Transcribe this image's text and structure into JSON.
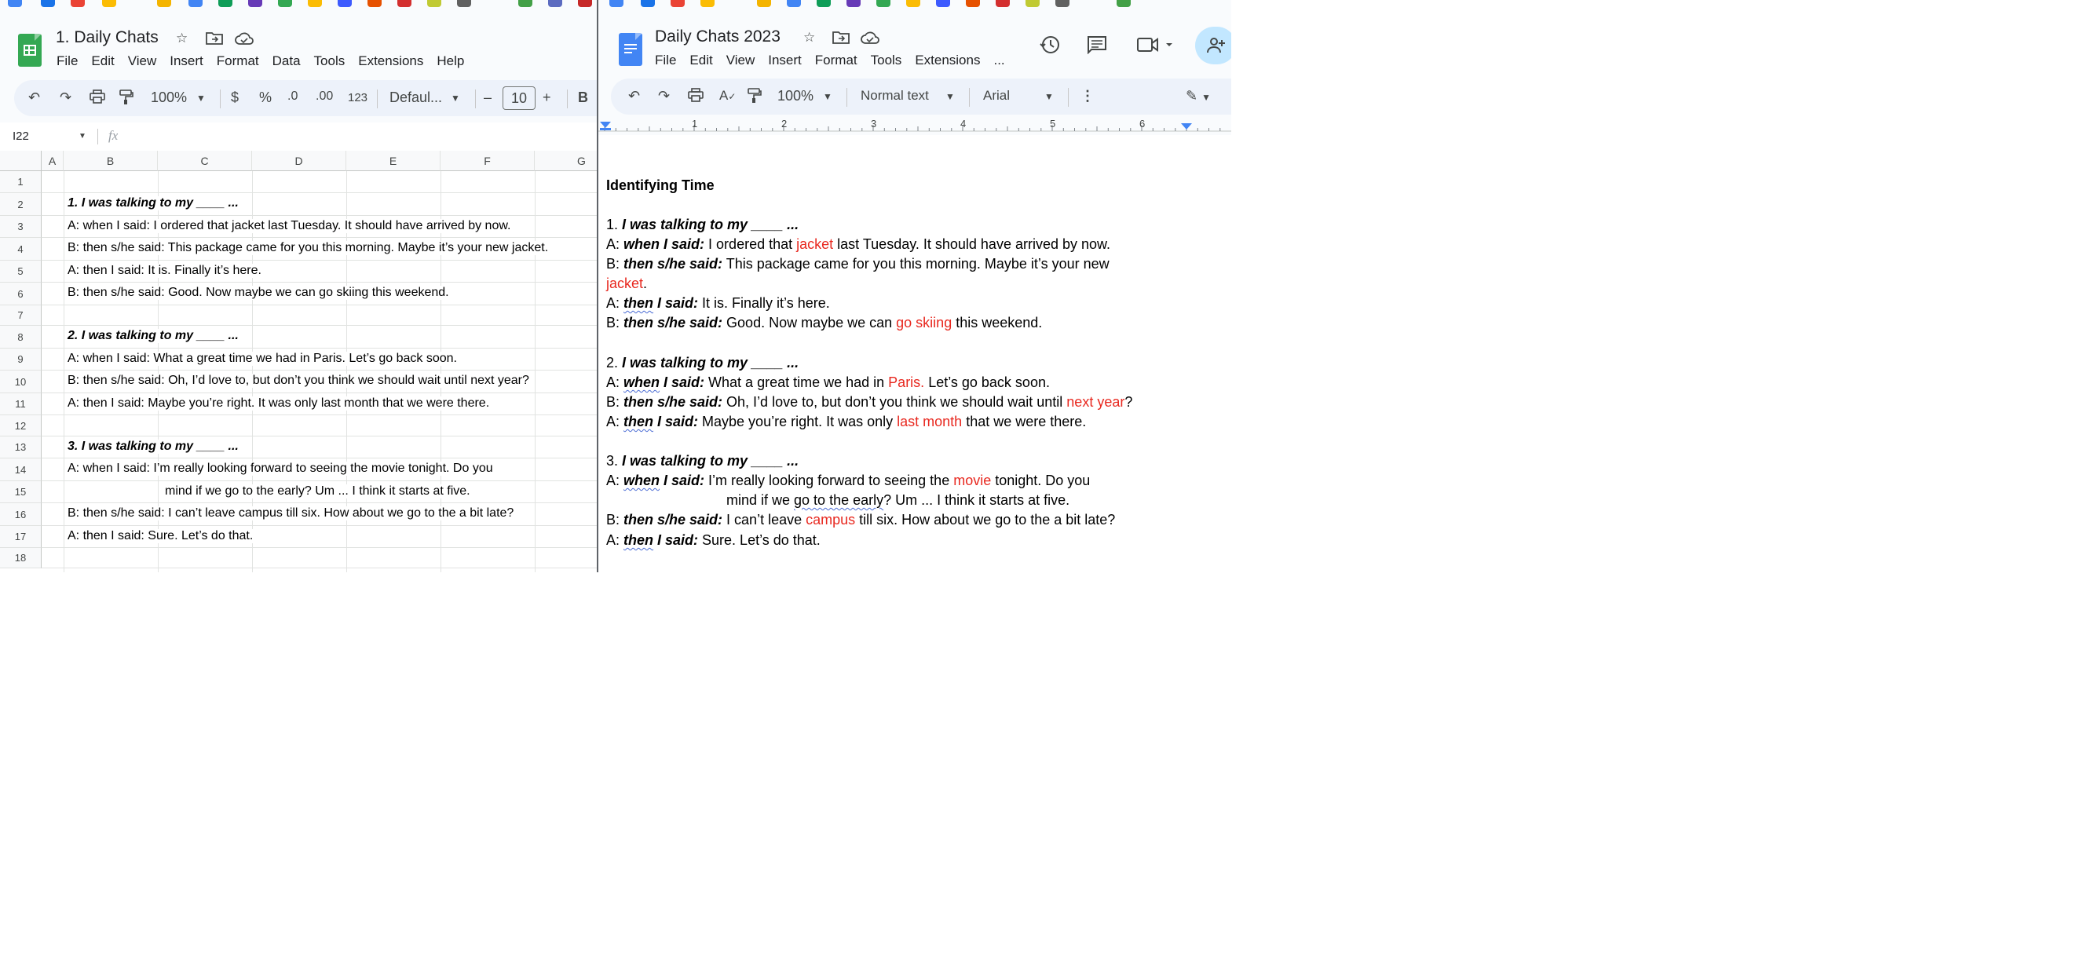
{
  "left_pane": {
    "title": "1. Daily Chats",
    "menu": [
      "File",
      "Edit",
      "View",
      "Insert",
      "Format",
      "Data",
      "Tools",
      "Extensions",
      "Help"
    ],
    "toolbar": {
      "zoom": "100%",
      "currency": "$",
      "percent": "%",
      "dec_decrease": ".0",
      "dec_increase": ".00",
      "number_format": "123",
      "font": "Defaul...",
      "minus": "–",
      "font_size": "10",
      "plus": "+",
      "bold": "B"
    },
    "name_box": "I22",
    "fx": "fx",
    "columns": [
      "A",
      "B",
      "C",
      "D",
      "E",
      "F",
      "G"
    ],
    "rows": [
      "1",
      "2",
      "3",
      "4",
      "5",
      "6",
      "7",
      "8",
      "9",
      "10",
      "11",
      "12",
      "13",
      "14",
      "15",
      "16",
      "17",
      "18"
    ],
    "cells": {
      "r2": "1. I was talking to my ____ ...",
      "r3": "A: when I said:  I ordered that jacket last Tuesday. It should have arrived by now.",
      "r4": "B: then s/he said:  This package came for you this morning. Maybe it’s your new jacket.",
      "r5": "A: then I said:  It is. Finally it’s here.",
      "r6": "B: then s/he said:  Good. Now maybe we can go skiing this weekend.",
      "r8": "2. I was talking to my ____ ...",
      "r9": "A: when I said:  What a great time we had in Paris. Let’s go back soon.",
      "r10": "B: then s/he said:  Oh, I’d love to, but don’t you think we should wait until next year?",
      "r11": "A: then I said:  Maybe you’re right. It was only last month that we were there.",
      "r13": "3. I was talking to my ____ ...",
      "r14": "A: when I said:  I’m really looking forward to seeing the movie tonight. Do you",
      "r15": "mind if we go to the early? Um ... I think it starts at five.",
      "r16": "B: then s/he said:  I can’t leave campus till six. How about we go to the a bit late?",
      "r17": "A: then I said:  Sure. Let’s do that."
    }
  },
  "right_pane": {
    "title": "Daily Chats 2023",
    "menu": [
      "File",
      "Edit",
      "View",
      "Insert",
      "Format",
      "Tools",
      "Extensions",
      "..."
    ],
    "toolbar": {
      "zoom": "100%",
      "style": "Normal text",
      "font": "Arial"
    },
    "ruler_numbers": [
      "1",
      "2",
      "3",
      "4",
      "5",
      "6"
    ],
    "doc": {
      "heading": "Identifying Time",
      "s1_num": "1. ",
      "s1_title": "I was talking to my ____ ...",
      "s2_num": "2. ",
      "s2_title": "I was talking to my ____ ...",
      "s3_num": "3. ",
      "s3_title": "I was talking to my ____ ...",
      "a": "A: ",
      "b": "B: ",
      "when": "when",
      "then": "then",
      "i_said": " I said:",
      "sh_said": "then s/he said:",
      "l1": [
        "  I ordered that ",
        "jacket",
        " last Tuesday. It should have arrived by now."
      ],
      "l2": [
        "  This package came for you this morning. Maybe it’s your new"
      ],
      "l3": [
        "jacket",
        "."
      ],
      "l4": [
        "  It is. Finally it’s here."
      ],
      "l5": [
        "  Good. Now maybe we can ",
        "go skiing",
        " this weekend."
      ],
      "l6": [
        "  What a great time we had in ",
        "Paris.",
        " Let’s go back soon."
      ],
      "l7": [
        "  Oh, I’d love to, but don’t you think we should wait until ",
        "next year",
        "?"
      ],
      "l8": [
        "  Maybe you’re right. It was only ",
        "last month",
        " that we were there."
      ],
      "l9": [
        "  I’m really looking forward to seeing the ",
        "movie",
        " tonight. Do you"
      ],
      "l10": [
        "mind if we ",
        "go to the early",
        "? Um ... I think it starts at five."
      ],
      "l11": [
        "  I can’t leave ",
        "campus",
        " till six. How about we go to the a bit late?"
      ],
      "l12": [
        "  Sure. Let’s do that."
      ]
    }
  },
  "colors": {
    "accent_red": "#e8281f",
    "sheets_green": "#34a853",
    "docs_blue": "#4285f4",
    "toolbar_bg": "#edf2fa"
  }
}
